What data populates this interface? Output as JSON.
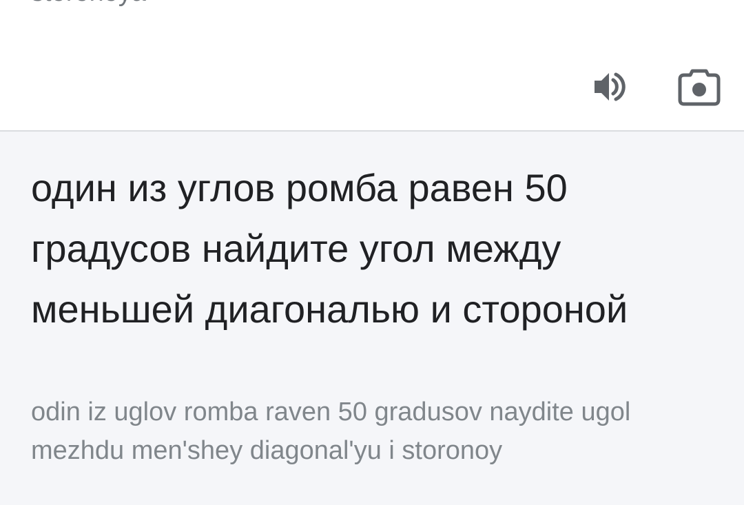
{
  "source": {
    "transliteration_cut": "storonoya",
    "speaker_icon": "speaker-icon",
    "camera_icon": "camera-icon"
  },
  "result": {
    "translation": "один из углов ромба равен 50 градусов найдите угол между меньшей диагональю и стороной",
    "transliteration": "odin iz uglov romba raven 50 gradusov naydite ugol mezhdu men'shey diagonal'yu i storonoy"
  },
  "colors": {
    "result_background": "#f5f6f9",
    "primary_text": "#202124",
    "secondary_text": "#80868b",
    "icon": "#5f6368"
  }
}
